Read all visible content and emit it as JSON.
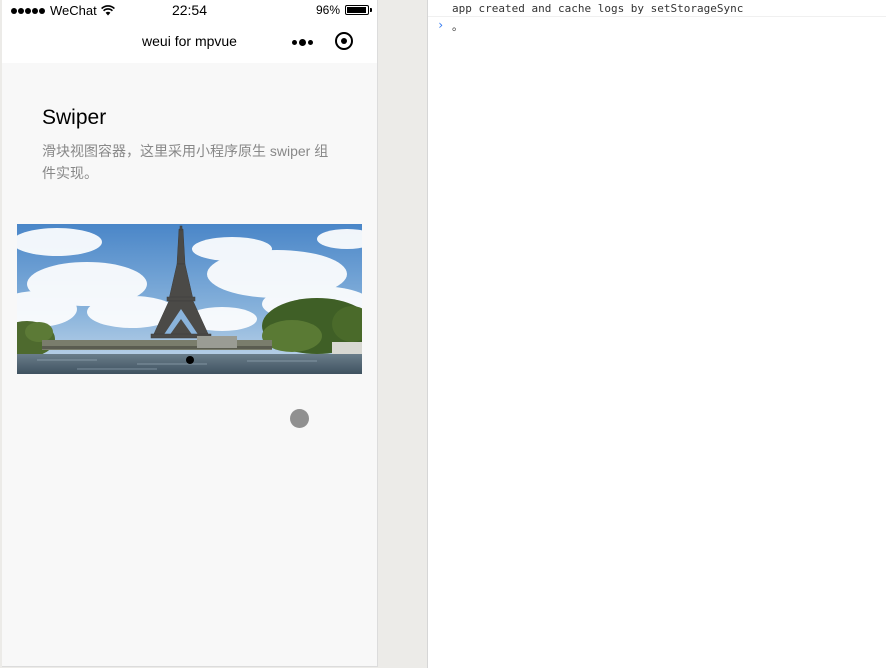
{
  "status_bar": {
    "carrier": "WeChat",
    "time": "22:54",
    "battery_percent": "96%",
    "battery_level": 0.96
  },
  "nav_bar": {
    "title": "weui for mpvue",
    "more_icon": "more-icon",
    "close_icon": "capsule-close-icon"
  },
  "page": {
    "title": "Swiper",
    "description": "滑块视图容器，这里采用小程序原生 swiper 组件实现。"
  },
  "swiper": {
    "image": "eiffel-tower-photo",
    "dots_count": 1,
    "active_index": 0
  },
  "console": {
    "log_line": "app created and cache logs by setStorageSync",
    "prompt_icon": "chevron-right-icon",
    "input_value": "。"
  }
}
